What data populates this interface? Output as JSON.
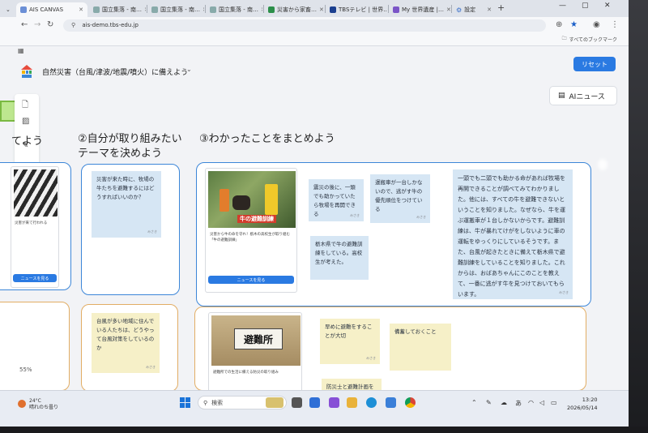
{
  "browser": {
    "tabs": [
      {
        "label": "AIS CANVAS",
        "active": true
      },
      {
        "label": "国立集落 - 南…"
      },
      {
        "label": "国立集落 - 南…"
      },
      {
        "label": "国立集落 - 南…"
      },
      {
        "label": "災害から家畜…"
      },
      {
        "label": "TBSテレビ | 世界…"
      },
      {
        "label": "My 世界遺産 |…"
      },
      {
        "label": "設定"
      }
    ],
    "url": "ais-demo.tbs-edu.jp",
    "bookmarks_label": "すべてのブックマーク"
  },
  "app": {
    "title": "自然災害（台風/津波/地震/噴火）に備えよう",
    "reset_label": "リセット",
    "ai_news_label": "AIニュース",
    "zoom": "55%"
  },
  "sections": {
    "col1_heading": "てよう",
    "col2_heading": "②自分が取り組みたいテーマを決めよう",
    "col3_heading": "③わかったことをまとめよう"
  },
  "notes": {
    "theme_blue": "災害が来た時に、牧場の牛たちを避難するにはどうすればいいのか？",
    "theme_orange": "台風が多い地域に住んでいる人たちは、どうやって台風対策をしているのか",
    "sum1": "震災の後に、一頭でも助かっていたら牧場を再開できる",
    "sum2": "運搬車が一台しかないので、逃がす牛の優先順位をつけている",
    "sum3": "栃木県で牛の避難訓練をしている。高校生が考えた。",
    "sum4": "一頭でも二頭でも助かる命があれば牧場を再開できることが調べてみてわかりました。他には、すべての牛を避難できないということを知りました。なぜなら、牛を運ぶ運搬車が１台しかないからです。避難訓練は、牛が暴れてけがをしないように車の運転をゆっくりにしているそうです。また、台風が起きたときに備えて栃木県で避難訓練をしていることを知りました。これからは、おばあちゃんにこのことを教えて、一番に逃がす牛を見つけておいてもらいます。",
    "sum5": "早めに避難をすることが大切",
    "sum6": "備蓄しておくこと",
    "sum7": "防災士と避難計画を"
  },
  "news": {
    "left_caption": "災害が来て行われる",
    "left_btn": "ニュースを見る",
    "card1_banner": "牛の避難訓練",
    "card1_caption": "災害から牛の命を守れ！栃木の高校生が取り組む「牛の避難訓練」",
    "card1_btn": "ニュースを見る",
    "card2_sign": "避難所",
    "card2_caption": "避難所での生活に備える防災の取り組み",
    "author_meta": "みさき"
  },
  "taskbar": {
    "weather_temp": "24°C",
    "weather_desc": "晴れのち曇り",
    "search_placeholder": "検索",
    "time": "13:20",
    "date": "2026/05/14"
  },
  "colors": {
    "accent": "#2a7ae2",
    "card_blue_border": "#3c86d8",
    "card_orange_border": "#e2ad64",
    "sticky_blue": "#d6e6f4",
    "sticky_yellow": "#f6f0c8"
  }
}
